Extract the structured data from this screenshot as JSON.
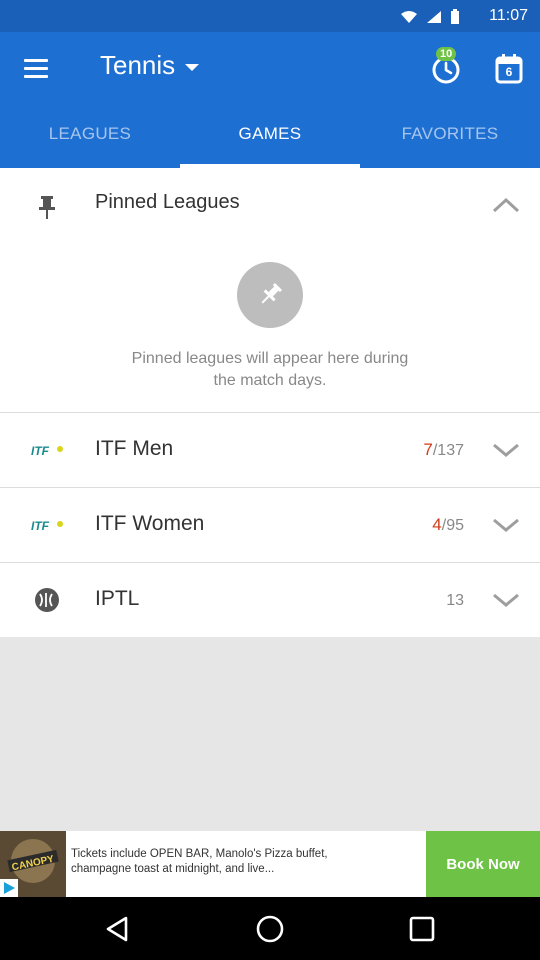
{
  "status_bar": {
    "time": "11:07"
  },
  "header": {
    "title": "Tennis",
    "notification_count": "10",
    "calendar_day": "6"
  },
  "tabs": [
    {
      "label": "LEAGUES",
      "active": false
    },
    {
      "label": "GAMES",
      "active": true
    },
    {
      "label": "FAVORITES",
      "active": false
    }
  ],
  "pinned": {
    "title": "Pinned Leagues",
    "empty_message": "Pinned leagues will appear here during the match days."
  },
  "leagues": [
    {
      "name": "ITF Men",
      "live": "7",
      "total": "/137",
      "logo": "itf-logo-icon"
    },
    {
      "name": "ITF Women",
      "live": "4",
      "total": "/95",
      "logo": "itf-logo-icon"
    },
    {
      "name": "IPTL",
      "live": "",
      "total": "13",
      "logo": "iptl-logo-icon"
    }
  ],
  "ad": {
    "text": "Tickets include OPEN BAR, Manolo's Pizza buffet, champagne toast at midnight, and live...",
    "cta": "Book Now",
    "thumb_label": "CANOPY"
  },
  "colors": {
    "app_bar": "#1e6fd2",
    "status_bar": "#1a60b8",
    "accent_green": "#6ec245",
    "live_red": "#d43a1a"
  }
}
